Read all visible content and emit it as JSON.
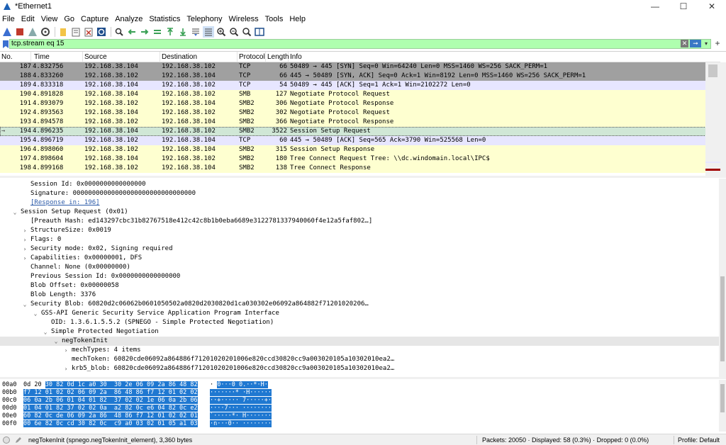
{
  "window": {
    "title": "*Ethernet1"
  },
  "menu": [
    "File",
    "Edit",
    "View",
    "Go",
    "Capture",
    "Analyze",
    "Statistics",
    "Telephony",
    "Wireless",
    "Tools",
    "Help"
  ],
  "filter": {
    "value": "tcp.stream eq 15"
  },
  "packet_list": {
    "columns": [
      "No.",
      "Time",
      "Source",
      "Destination",
      "Protocol",
      "Length",
      "Info"
    ],
    "rows": [
      {
        "no": "187",
        "time": "4.832756",
        "src": "192.168.38.104",
        "dst": "192.168.38.102",
        "proto": "TCP",
        "len": "66",
        "info": "50489 → 445 [SYN] Seq=0 Win=64240 Len=0 MSS=1460 WS=256 SACK_PERM=1",
        "style": "gray"
      },
      {
        "no": "188",
        "time": "4.833260",
        "src": "192.168.38.102",
        "dst": "192.168.38.104",
        "proto": "TCP",
        "len": "66",
        "info": "445 → 50489 [SYN, ACK] Seq=0 Ack=1 Win=8192 Len=0 MSS=1460 WS=256 SACK_PERM=1",
        "style": "gray"
      },
      {
        "no": "189",
        "time": "4.833318",
        "src": "192.168.38.104",
        "dst": "192.168.38.102",
        "proto": "TCP",
        "len": "54",
        "info": "50489 → 445 [ACK] Seq=1 Ack=1 Win=2102272 Len=0",
        "style": "tcp"
      },
      {
        "no": "190",
        "time": "4.891828",
        "src": "192.168.38.104",
        "dst": "192.168.38.102",
        "proto": "SMB",
        "len": "127",
        "info": "Negotiate Protocol Request",
        "style": "smb"
      },
      {
        "no": "191",
        "time": "4.893079",
        "src": "192.168.38.102",
        "dst": "192.168.38.104",
        "proto": "SMB2",
        "len": "306",
        "info": "Negotiate Protocol Response",
        "style": "smb"
      },
      {
        "no": "192",
        "time": "4.893563",
        "src": "192.168.38.104",
        "dst": "192.168.38.102",
        "proto": "SMB2",
        "len": "302",
        "info": "Negotiate Protocol Request",
        "style": "smb"
      },
      {
        "no": "193",
        "time": "4.894578",
        "src": "192.168.38.102",
        "dst": "192.168.38.104",
        "proto": "SMB2",
        "len": "366",
        "info": "Negotiate Protocol Response",
        "style": "smb"
      },
      {
        "no": "194",
        "time": "4.896235",
        "src": "192.168.38.104",
        "dst": "192.168.38.102",
        "proto": "SMB2",
        "len": "3522",
        "info": "Session Setup Request",
        "style": "selected"
      },
      {
        "no": "195",
        "time": "4.896719",
        "src": "192.168.38.102",
        "dst": "192.168.38.104",
        "proto": "TCP",
        "len": "60",
        "info": "445 → 50489 [ACK] Seq=565 Ack=3790 Win=525568 Len=0",
        "style": "tcp"
      },
      {
        "no": "196",
        "time": "4.898060",
        "src": "192.168.38.102",
        "dst": "192.168.38.104",
        "proto": "SMB2",
        "len": "315",
        "info": "Session Setup Response",
        "style": "smb"
      },
      {
        "no": "197",
        "time": "4.898604",
        "src": "192.168.38.104",
        "dst": "192.168.38.102",
        "proto": "SMB2",
        "len": "180",
        "info": "Tree Connect Request Tree: \\\\dc.windomain.local\\IPC$",
        "style": "smb"
      },
      {
        "no": "198",
        "time": "4.899168",
        "src": "192.168.38.102",
        "dst": "192.168.38.104",
        "proto": "SMB2",
        "len": "138",
        "info": "Tree Connect Response",
        "style": "smb"
      }
    ]
  },
  "details": [
    {
      "indent": 43,
      "tw": "",
      "text": "Session Id: 0x0000000000000000"
    },
    {
      "indent": 43,
      "tw": "",
      "text": "Signature: 00000000000000000000000000000000"
    },
    {
      "indent": 43,
      "tw": "",
      "text": "[Response in: 196]",
      "link": true
    },
    {
      "indent": 29,
      "tw": "⌄",
      "text": "Session Setup Request (0x01)"
    },
    {
      "indent": 43,
      "tw": "",
      "text": "[Preauth Hash: ed143297cbc31b82767518e412c42c8b1b0eba6689e3122781337940060f4e12a5faf802…]"
    },
    {
      "indent": 43,
      "tw": "›",
      "text": "StructureSize: 0x0019"
    },
    {
      "indent": 43,
      "tw": "›",
      "text": "Flags: 0"
    },
    {
      "indent": 43,
      "tw": "›",
      "text": "Security mode: 0x02, Signing required"
    },
    {
      "indent": 43,
      "tw": "›",
      "text": "Capabilities: 0x00000001, DFS"
    },
    {
      "indent": 43,
      "tw": "",
      "text": "Channel: None (0x00000000)"
    },
    {
      "indent": 43,
      "tw": "",
      "text": "Previous Session Id: 0x0000000000000000"
    },
    {
      "indent": 43,
      "tw": "",
      "text": "Blob Offset: 0x00000058"
    },
    {
      "indent": 43,
      "tw": "",
      "text": "Blob Length: 3376"
    },
    {
      "indent": 43,
      "tw": "⌄",
      "text": "Security Blob: 60820d2c06062b0601050502a0820d2030820d1ca030302e06092a864882f71201020206…"
    },
    {
      "indent": 58,
      "tw": "⌄",
      "text": "GSS-API Generic Security Service Application Program Interface"
    },
    {
      "indent": 72,
      "tw": "",
      "text": "OID: 1.3.6.1.5.5.2 (SPNEGO - Simple Protected Negotiation)"
    },
    {
      "indent": 72,
      "tw": "⌄",
      "text": "Simple Protected Negotiation"
    },
    {
      "indent": 87,
      "tw": "⌄",
      "text": "negTokenInit",
      "hl": true
    },
    {
      "indent": 101,
      "tw": "›",
      "text": "mechTypes: 4 items"
    },
    {
      "indent": 101,
      "tw": "",
      "text": "mechToken: 60820cde06092a864886f71201020201006e820ccd30820cc9a003020105a10302010ea2…"
    },
    {
      "indent": 101,
      "tw": "›",
      "text": "krb5_blob: 60820cde06092a864886f71201020201006e820ccd30820cc9a003020105a10302010ea2…"
    }
  ],
  "bytes": [
    {
      "off": "00a0",
      "pre": "0d 20 ",
      "hex": "30 82 0d 1c a0 30  30 2e 06 09 2a 86 48 82",
      "pre_ascii": "· ",
      "ascii": "0···0 0.··*·H·"
    },
    {
      "off": "00b0",
      "pre": "",
      "hex": "f7 12 01 02 02 06 09 2a  86 48 86 f7 12 01 02 02",
      "pre_ascii": "",
      "ascii": "·······* ·H······"
    },
    {
      "off": "00c0",
      "pre": "",
      "hex": "06 0a 2b 06 01 04 01 82  37 02 02 1e 06 0a 2b 06",
      "pre_ascii": "",
      "ascii": "··+····· 7·····+·"
    },
    {
      "off": "00d0",
      "pre": "",
      "hex": "01 04 01 82 37 02 02 0a  a2 82 0c e6 04 82 0c e2",
      "pre_ascii": "",
      "ascii": "····7··· ········"
    },
    {
      "off": "00e0",
      "pre": "",
      "hex": "60 82 0c de 06 09 2a 86  48 86 f7 12 01 02 02 01",
      "pre_ascii": "",
      "ascii": "`·····*· H·······"
    },
    {
      "off": "00f0",
      "pre": "",
      "hex": "00 6e 82 0c cd 30 82 0c  c9 a0 03 02 01 05 a1 03",
      "pre_ascii": "",
      "ascii": "·n···0·· ········"
    }
  ],
  "status": {
    "field": "negTokenInit (spnego.negTokenInit_element), 3,360 bytes",
    "stats": "Packets: 20050 · Displayed: 58 (0.3%) · Dropped: 0 (0.0%)",
    "profile": "Profile: Default"
  }
}
